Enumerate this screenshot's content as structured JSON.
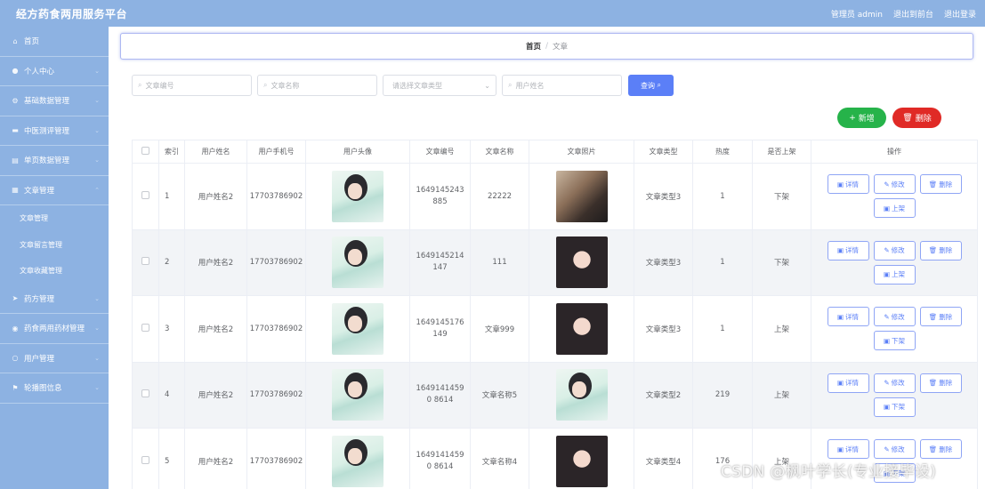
{
  "app": {
    "title": "经方药食两用服务平台",
    "admin_label": "管理员 admin",
    "back_label": "退出到前台",
    "logout_label": "退出登录"
  },
  "sidebar": {
    "items": [
      {
        "label": "首页",
        "icon": "home-icon"
      },
      {
        "label": "个人中心",
        "icon": "user-icon"
      },
      {
        "label": "基础数据管理",
        "icon": "gear-icon"
      },
      {
        "label": "中医测评管理",
        "icon": "list-icon"
      },
      {
        "label": "单页数据管理",
        "icon": "doc-icon"
      },
      {
        "label": "文章管理",
        "icon": "grid-icon"
      }
    ],
    "sub_items": [
      "文章管理",
      "文章留言管理",
      "文章收藏管理"
    ],
    "items_after": [
      {
        "label": "药方管理",
        "icon": "send-icon"
      },
      {
        "label": "药食两用药材管理",
        "icon": "location-icon"
      },
      {
        "label": "用户管理",
        "icon": "clock-icon"
      },
      {
        "label": "轮播图信息",
        "icon": "flag-icon"
      }
    ]
  },
  "breadcrumb": {
    "home": "首页",
    "separator": "/",
    "current": "文章"
  },
  "search": {
    "article_no_placeholder": "文章编号",
    "article_name_placeholder": "文章名称",
    "article_type_placeholder": "请选择文章类型",
    "user_name_placeholder": "用户姓名",
    "query_label": "查询"
  },
  "actions": {
    "add_label": "新增",
    "delete_label": "删除"
  },
  "table": {
    "headers": [
      "索引",
      "用户姓名",
      "用户手机号",
      "用户头像",
      "文章编号",
      "文章名称",
      "文章照片",
      "文章类型",
      "热度",
      "是否上架",
      "操作"
    ],
    "rows": [
      {
        "index": "1",
        "user": "用户姓名2",
        "phone": "17703786902",
        "no": "1649145243885",
        "name": "22222",
        "type": "文章类型3",
        "heat": "1",
        "status": "下架",
        "toggle": "上架"
      },
      {
        "index": "2",
        "user": "用户姓名2",
        "phone": "17703786902",
        "no": "1649145214147",
        "name": "111",
        "type": "文章类型3",
        "heat": "1",
        "status": "下架",
        "toggle": "上架"
      },
      {
        "index": "3",
        "user": "用户姓名2",
        "phone": "17703786902",
        "no": "1649145176149",
        "name": "文章999",
        "type": "文章类型3",
        "heat": "1",
        "status": "上架",
        "toggle": "下架"
      },
      {
        "index": "4",
        "user": "用户姓名2",
        "phone": "17703786902",
        "no": "16491414590 8614",
        "name": "文章名称5",
        "type": "文章类型2",
        "heat": "219",
        "status": "上架",
        "toggle": "下架"
      },
      {
        "index": "5",
        "user": "用户姓名2",
        "phone": "17703786902",
        "no": "16491414590 8614",
        "name": "文章名称4",
        "type": "文章类型4",
        "heat": "176",
        "status": "上架",
        "toggle": "下架"
      }
    ],
    "op_detail": "详情",
    "op_edit": "修改",
    "op_delete": "删除"
  },
  "watermark": "CSDN @枫叶学长(专业接毕设)"
}
